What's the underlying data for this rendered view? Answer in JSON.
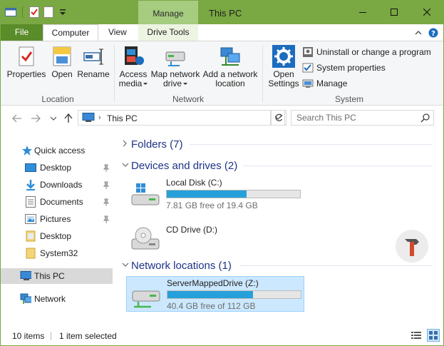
{
  "window": {
    "title": "This PC",
    "contextual_tab": "Manage",
    "accent_color": "#7aa843"
  },
  "tabs": {
    "file": "File",
    "computer": "Computer",
    "view": "View",
    "drive_tools": "Drive Tools"
  },
  "ribbon": {
    "location": {
      "label": "Location",
      "properties": "Properties",
      "open": "Open",
      "rename": "Rename"
    },
    "network": {
      "label": "Network",
      "access_media_1": "Access",
      "access_media_2": "media",
      "map_drive_1": "Map network",
      "map_drive_2": "drive",
      "add_location_1": "Add a network",
      "add_location_2": "location"
    },
    "system": {
      "label": "System",
      "open_settings_1": "Open",
      "open_settings_2": "Settings",
      "uninstall": "Uninstall or change a program",
      "system_properties": "System properties",
      "manage": "Manage"
    }
  },
  "address": {
    "path": "This PC",
    "search_placeholder": "Search This PC"
  },
  "nav": {
    "quick_access": "Quick access",
    "items": [
      {
        "label": "Desktop",
        "icon": "desktop-icon",
        "pinned": true
      },
      {
        "label": "Downloads",
        "icon": "downloads-icon",
        "pinned": true
      },
      {
        "label": "Documents",
        "icon": "documents-icon",
        "pinned": true
      },
      {
        "label": "Pictures",
        "icon": "pictures-icon",
        "pinned": true
      },
      {
        "label": "Desktop",
        "icon": "folder-icon",
        "pinned": false
      },
      {
        "label": "System32",
        "icon": "folder-icon",
        "pinned": false
      }
    ],
    "this_pc": "This PC",
    "network": "Network"
  },
  "content": {
    "folders_header": "Folders (7)",
    "devices_header": "Devices and drives (2)",
    "network_header": "Network locations (1)",
    "drives": [
      {
        "name": "Local Disk (C:)",
        "free_text": "7.81 GB free of 19.4 GB",
        "used_fraction": 0.6
      },
      {
        "name": "CD Drive (D:)"
      }
    ],
    "network_drives": [
      {
        "name": "ServerMappedDrive (Z:)",
        "free_text": "40.4 GB free of 112 GB",
        "used_fraction": 0.64
      }
    ]
  },
  "status": {
    "items_count": "10 items",
    "selected": "1 item selected"
  }
}
